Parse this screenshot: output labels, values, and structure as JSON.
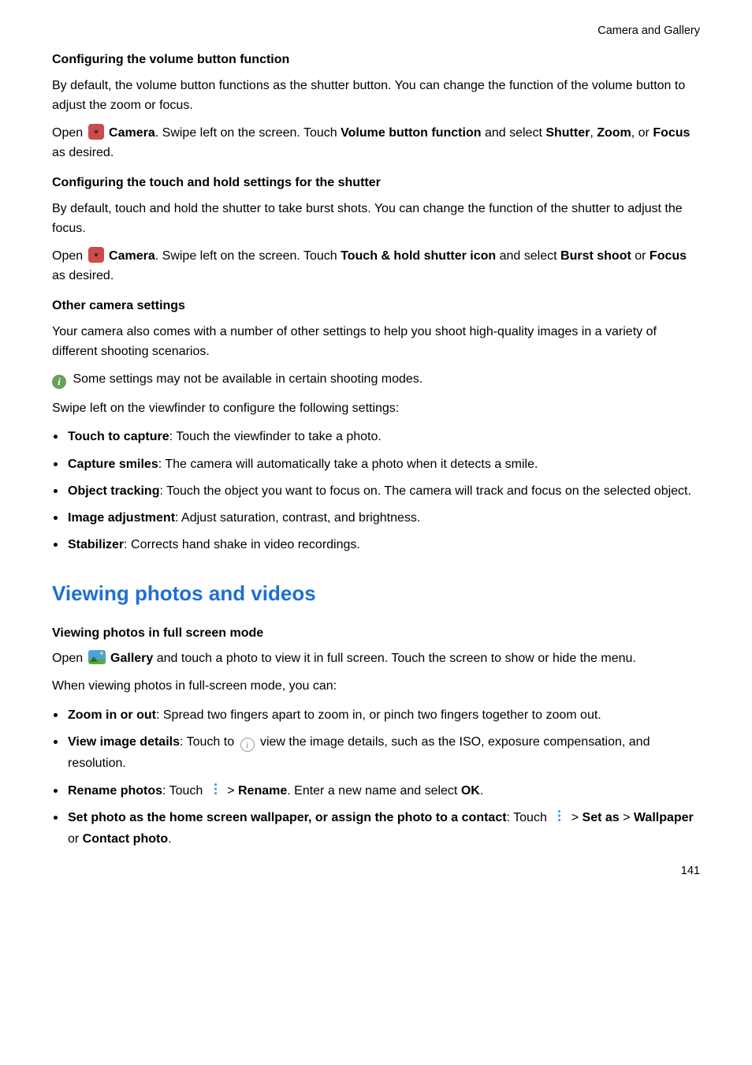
{
  "header": {
    "section": "Camera and Gallery"
  },
  "s1": {
    "h": "Configuring the volume button function",
    "p1": "By default, the volume button functions as the shutter button. You can change the function of the volume button to adjust the zoom or focus.",
    "p2_a": "Open ",
    "p2_b": " Camera",
    "p2_c": ". Swipe left on the screen. Touch ",
    "p2_d": "Volume button function",
    "p2_e": " and select ",
    "p2_f": "Shutter",
    "p2_g": ", ",
    "p2_h": "Zoom",
    "p2_i": ", or ",
    "p2_j": "Focus",
    "p2_k": " as desired."
  },
  "s2": {
    "h": "Configuring the touch and hold settings for the shutter",
    "p1": "By default, touch and hold the shutter to take burst shots. You can change the function of the shutter to adjust the focus.",
    "p2_a": "Open ",
    "p2_b": " Camera",
    "p2_c": ". Swipe left on the screen. Touch ",
    "p2_d": "Touch & hold shutter icon",
    "p2_e": " and select ",
    "p2_f": "Burst shoot",
    "p2_g": " or ",
    "p2_h": "Focus",
    "p2_i": " as desired."
  },
  "s3": {
    "h": "Other camera settings",
    "p1": "Your camera also comes with a number of other settings to help you shoot high-quality images in a variety of different shooting scenarios.",
    "note": " Some settings may not be available in certain shooting modes.",
    "p2": "Swipe left on the viewfinder to configure the following settings:",
    "b1_a": "Touch to capture",
    "b1_b": ": Touch the viewfinder to take a photo.",
    "b2_a": "Capture smiles",
    "b2_b": ": The camera will automatically take a photo when it detects a smile.",
    "b3_a": "Object tracking",
    "b3_b": ": Touch the object you want to focus on. The camera will track and focus on the selected object.",
    "b4_a": "Image adjustment",
    "b4_b": ": Adjust saturation, contrast, and brightness.",
    "b5_a": "Stabilizer",
    "b5_b": ": Corrects hand shake in video recordings."
  },
  "s4": {
    "h": "Viewing photos and videos",
    "sub": "Viewing photos in full screen mode",
    "p1_a": "Open ",
    "p1_b": " Gallery",
    "p1_c": " and touch a photo to view it in full screen. Touch the screen to show or hide the menu.",
    "p2": "When viewing photos in full-screen mode, you can:",
    "b1_a": "Zoom in or out",
    "b1_b": ": Spread two fingers apart to zoom in, or pinch two fingers together to zoom out.",
    "b2_a": "View image details",
    "b2_b": ": Touch to ",
    "b2_c": " view the image details, such as the ISO, exposure compensation, and resolution.",
    "b3_a": "Rename photos",
    "b3_b": ": Touch ",
    "b3_c": " > ",
    "b3_d": "Rename",
    "b3_e": ". Enter a new name and select ",
    "b3_f": "OK",
    "b3_g": ".",
    "b4_a": "Set photo as the home screen wallpaper, or assign the photo to a contact",
    "b4_b": ": Touch ",
    "b4_c": " > ",
    "b4_d": "Set as",
    "b4_e": " > ",
    "b4_f": "Wallpaper",
    "b4_g": " or ",
    "b4_h": "Contact photo",
    "b4_i": "."
  },
  "page": "141",
  "glyphs": {
    "i": "i",
    "ci": "i"
  }
}
